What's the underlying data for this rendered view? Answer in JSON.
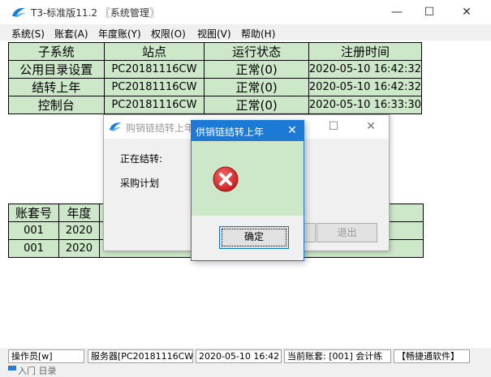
{
  "window": {
    "title": "T3-标准版11.2 〖系统管理〗",
    "minimize_glyph": "—",
    "maximize_glyph": "☐",
    "close_glyph": "✕"
  },
  "menu": [
    "系统(S)",
    "账套(A)",
    "年度账(Y)",
    "权限(O)",
    "视图(V)",
    "帮助(H)"
  ],
  "system_table": {
    "headers": [
      "子系统",
      "站点",
      "运行状态",
      "注册时间"
    ],
    "rows": [
      [
        "公用目录设置",
        "PC20181116CW",
        "正常(0)",
        "2020-05-10 16:42:32"
      ],
      [
        "结转上年",
        "PC20181116CW",
        "正常(0)",
        "2020-05-10 16:42:32"
      ],
      [
        "控制台",
        "PC20181116CW",
        "正常(0)",
        "2020-05-10 16:33:30"
      ]
    ]
  },
  "account_table": {
    "headers": [
      "账套号",
      "年度",
      "",
      ""
    ],
    "rows": [
      [
        "001",
        "2020",
        "",
        ""
      ],
      [
        "001",
        "2020",
        "",
        ""
      ]
    ]
  },
  "progress_dialog": {
    "title": "购销链结转上年",
    "label": "正在结转:",
    "item": "采购计划",
    "exit_label": "退出",
    "maximize_glyph": "☐",
    "close_glyph": "✕"
  },
  "error_dialog": {
    "title": "供销链结转上年",
    "close_glyph": "✕",
    "ok_label": "确定"
  },
  "statusbar": {
    "operator": "操作员[w]",
    "server": "服务器[PC20181116CW]",
    "datetime": "2020-05-10 16:42",
    "account": "当前账套: [001] 会计练",
    "brand": "【畅捷通软件】"
  },
  "below_text": "入门 日录",
  "colors": {
    "table_bg": "#cde8c8",
    "accent": "#1c79d4",
    "error_red": "#d32f2f"
  }
}
